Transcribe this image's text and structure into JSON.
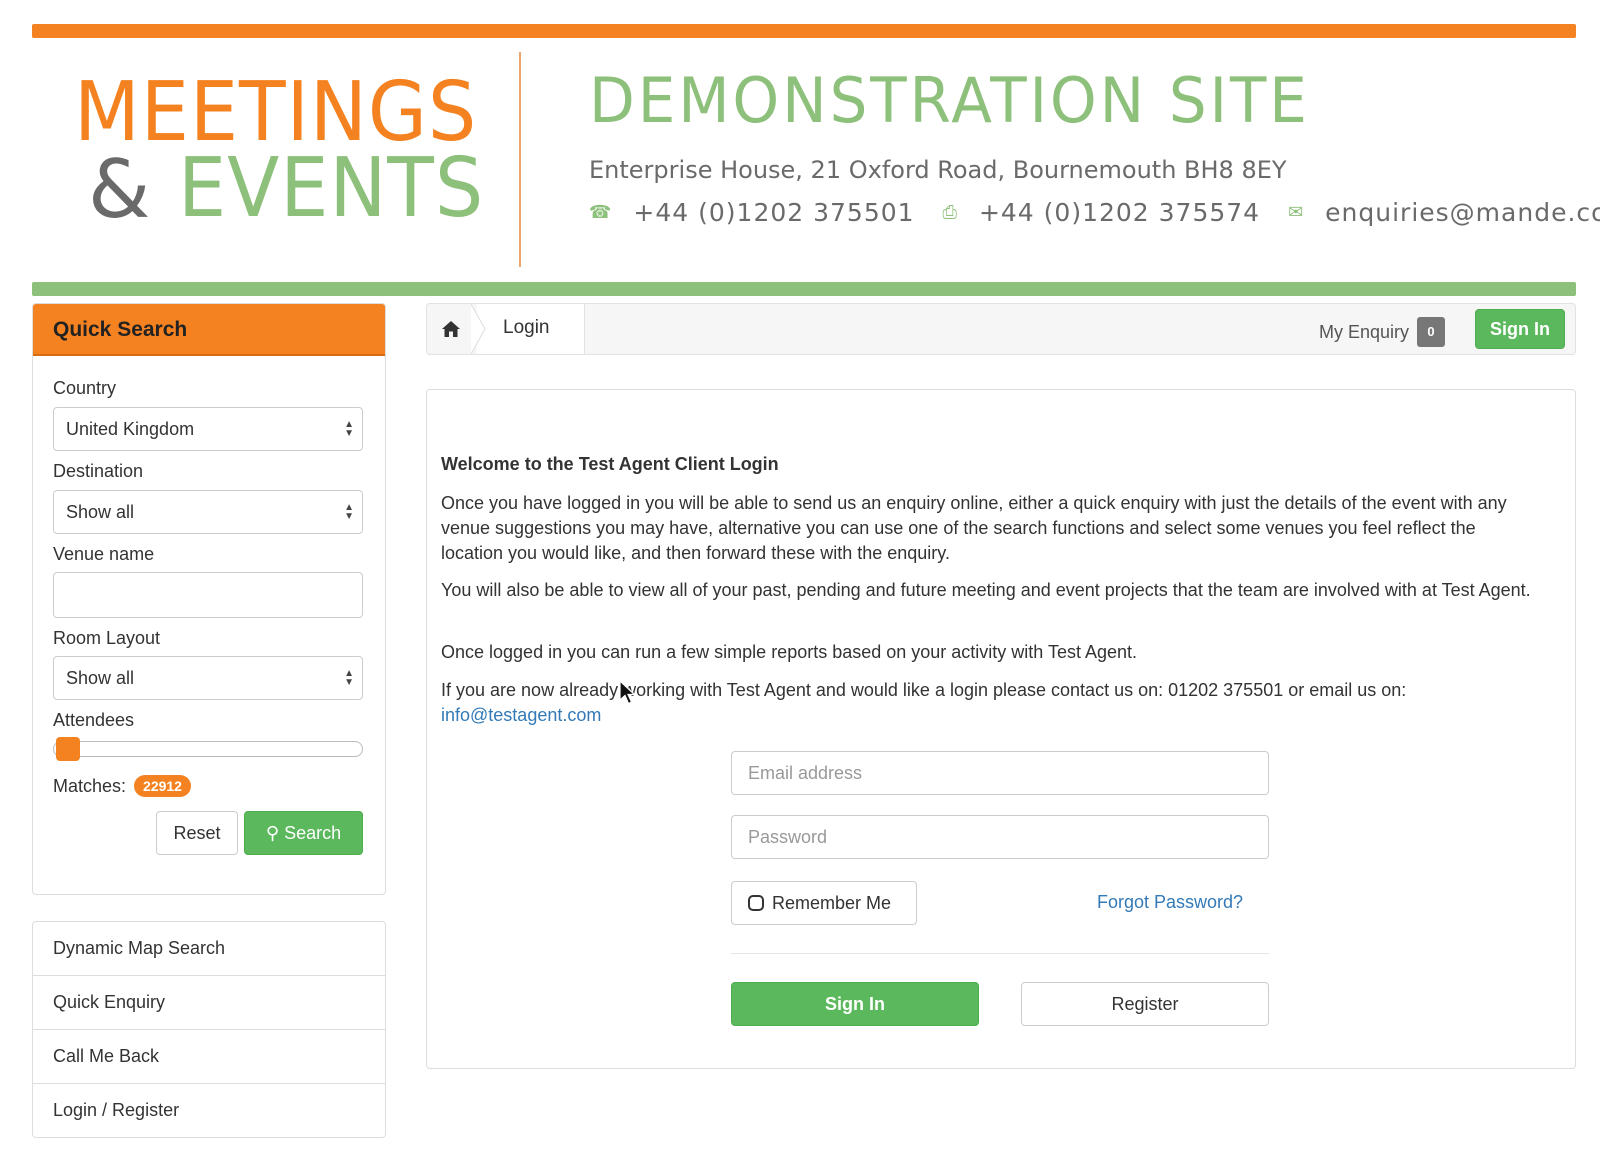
{
  "brand": {
    "logo_line1": "MEETINGS",
    "logo_amp": "&",
    "logo_line2": "EVENTS",
    "site_title": "DEMONSTRATION SITE",
    "address": "Enterprise House, 21 Oxford Road, Bournemouth BH8 8EY",
    "phone": "+44 (0)1202 375501",
    "fax": "+44 (0)1202 375574",
    "email": "enquiries@mande.com",
    "orange": "#f58220",
    "green": "#8dc07a",
    "icons": [
      "phone-icon",
      "fax-icon",
      "envelope-icon"
    ]
  },
  "quick_search": {
    "title": "Quick Search",
    "country_label": "Country",
    "country_value": "United Kingdom",
    "destination_label": "Destination",
    "destination_value": "Show all",
    "venue_label": "Venue name",
    "venue_value": "",
    "layout_label": "Room Layout",
    "layout_value": "Show all",
    "attendees_label": "Attendees",
    "attendees_level": 0,
    "matches_label": "Matches:",
    "matches_count": "22912",
    "reset_label": "Reset",
    "search_label": "Search"
  },
  "side_links": [
    "Dynamic Map Search",
    "Quick Enquiry",
    "Call Me Back",
    "Login / Register"
  ],
  "breadcrumb": {
    "current": "Login",
    "my_enquiry_label": "My Enquiry",
    "my_enquiry_count": "0",
    "signin_label": "Sign In"
  },
  "login": {
    "heading": "Welcome to the Test Agent Client Login",
    "p1": "Once you have logged in you will be able to send us an enquiry online, either a quick enquiry with just the details of the event with any venue suggestions you may have, alternative you can use one of the search functions and select some venues you feel reflect the location you would like, and then forward these with the enquiry.",
    "p2": "You will also be able to view all of your past, pending and future meeting and event projects that the team are involved with at Test Agent.",
    "p3": "Once logged in you can run a few simple reports based on your activity with Test Agent.",
    "p4": "If you are now already working with Test Agent and would like a login please contact us on: 01202 375501 or email us on:",
    "contact_email": "info@testagent.com",
    "email_placeholder": "Email address",
    "password_placeholder": "Password",
    "remember_label": "Remember Me",
    "forgot_label": "Forgot Password?",
    "signin_label": "Sign In",
    "register_label": "Register"
  }
}
